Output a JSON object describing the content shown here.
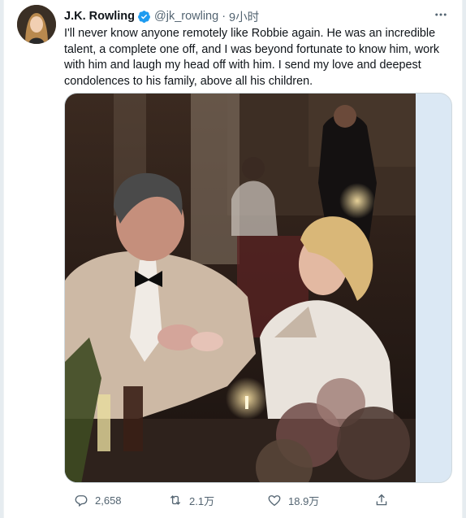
{
  "author": {
    "name": "J.K. Rowling",
    "handle": "@jk_rowling",
    "time": "9小时",
    "separator": "·"
  },
  "tweet": {
    "text": "I'll never know anyone remotely like Robbie again. He was an incredible\ntalent, a complete one off, and I was beyond fortunate to know him, work\nwith him and laugh my head off with him. I send my love and deepest\ncondolences to his family, above all his children."
  },
  "actions": {
    "reply_count": "2,658",
    "retweet_count": "2.1万",
    "like_count": "18.9万"
  },
  "icons": [
    "verified-icon",
    "more-icon",
    "reply-icon",
    "retweet-icon",
    "like-icon",
    "share-icon"
  ],
  "colors": {
    "verified": "#1d9bf0",
    "muted": "#536471",
    "text": "#0f1419"
  }
}
